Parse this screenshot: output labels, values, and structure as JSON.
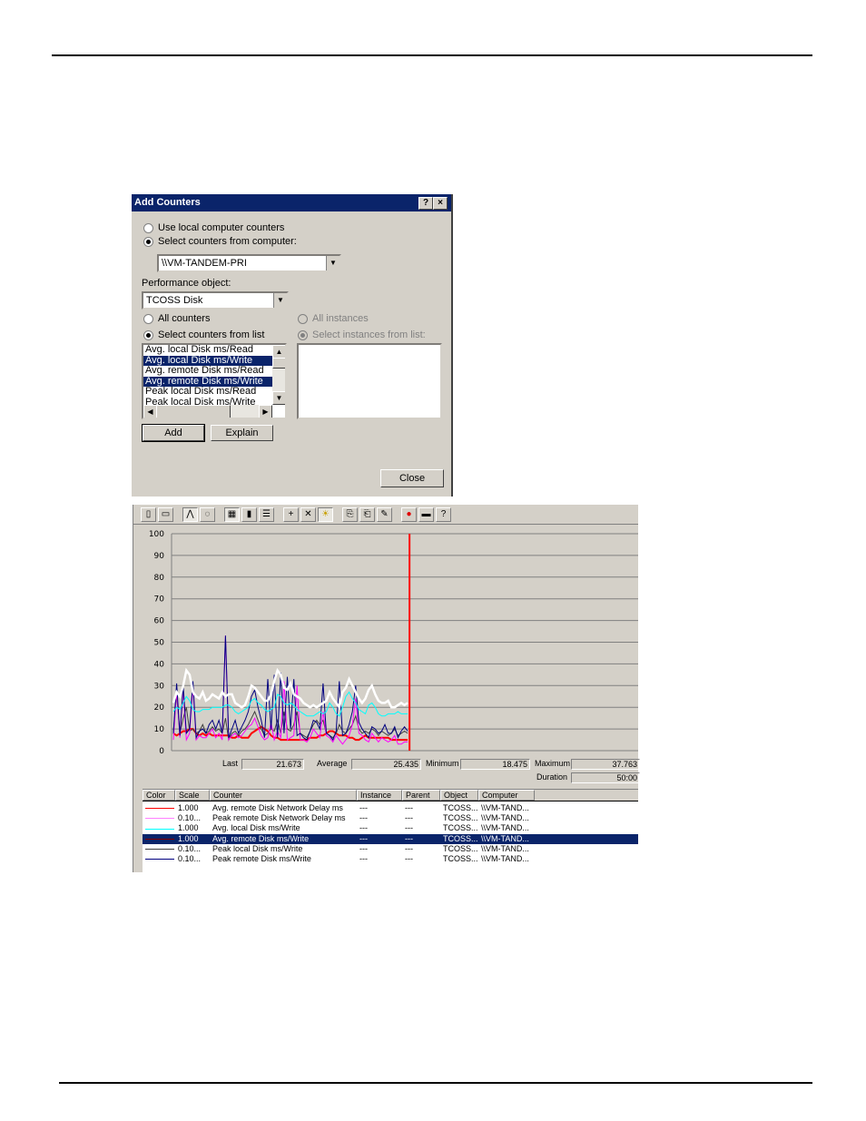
{
  "page": {
    "top_rule": true,
    "bottom_rule": true
  },
  "dialog": {
    "title": "Add Counters",
    "help_button": "?",
    "close_button": "×",
    "radio_local": "Use local computer counters",
    "radio_select": "Select counters from computer:",
    "computer_value": "\\\\VM-TANDEM-PRI",
    "performance_object_label": "Performance object:",
    "performance_object_value": "TCOSS Disk",
    "radio_all_counters": "All counters",
    "radio_select_counters": "Select counters from list",
    "radio_all_instances": "All instances",
    "radio_select_instances": "Select instances from list:",
    "counters": [
      {
        "label": "Avg. local Disk ms/Read",
        "selected": false
      },
      {
        "label": "Avg. local Disk ms/Write",
        "selected": true
      },
      {
        "label": "Avg. remote Disk ms/Read",
        "selected": false
      },
      {
        "label": "Avg. remote Disk ms/Write",
        "selected": true
      },
      {
        "label": "Peak local Disk ms/Read",
        "selected": false
      },
      {
        "label": "Peak local Disk ms/Write",
        "selected": false
      }
    ],
    "add_button": "Add",
    "explain_button": "Explain",
    "close_label": "Close"
  },
  "perfmon": {
    "toolbar_icons": [
      "new-counter-set-icon",
      "clear-display-icon",
      "view-current-activity-icon",
      "view-log-data-icon",
      "view-graph-icon",
      "view-histogram-icon",
      "view-report-icon",
      "add-icon",
      "delete-icon",
      "highlight-icon",
      "copy-properties-icon",
      "paste-counter-list-icon",
      "properties-icon",
      "freeze-display-icon",
      "update-data-icon",
      "help-icon"
    ],
    "stats": {
      "last_label": "Last",
      "last_value": "21.673",
      "average_label": "Average",
      "average_value": "25.435",
      "minimum_label": "Minimum",
      "minimum_value": "18.475",
      "maximum_label": "Maximum",
      "maximum_value": "37.763",
      "duration_label": "Duration",
      "duration_value": "50:00"
    },
    "legend_headers": [
      "Color",
      "Scale",
      "Counter",
      "Instance",
      "Parent",
      "Object",
      "Computer"
    ],
    "legend_rows": [
      {
        "color": "#ff0000",
        "scale": "1.000",
        "counter": "Avg. remote Disk Network Delay ms",
        "instance": "---",
        "parent": "---",
        "object": "TCOSS...",
        "computer": "\\\\VM-TAND...",
        "selected": false
      },
      {
        "color": "#ff80ff",
        "scale": "0.10...",
        "counter": "Peak remote Disk Network Delay ms",
        "instance": "---",
        "parent": "---",
        "object": "TCOSS...",
        "computer": "\\\\VM-TAND...",
        "selected": false
      },
      {
        "color": "#00ffff",
        "scale": "1.000",
        "counter": "Avg. local Disk ms/Write",
        "instance": "---",
        "parent": "---",
        "object": "TCOSS...",
        "computer": "\\\\VM-TAND...",
        "selected": false
      },
      {
        "color": "#800000",
        "scale": "1.000",
        "counter": "Avg. remote Disk ms/Write",
        "instance": "---",
        "parent": "---",
        "object": "TCOSS...",
        "computer": "\\\\VM-TAND...",
        "selected": true
      },
      {
        "color": "#404040",
        "scale": "0.10...",
        "counter": "Peak local Disk ms/Write",
        "instance": "---",
        "parent": "---",
        "object": "TCOSS...",
        "computer": "\\\\VM-TAND...",
        "selected": false
      },
      {
        "color": "#000080",
        "scale": "0.10...",
        "counter": "Peak remote Disk ms/Write",
        "instance": "---",
        "parent": "---",
        "object": "TCOSS...",
        "computer": "\\\\VM-TAND...",
        "selected": false
      }
    ]
  },
  "chart_data": {
    "type": "line",
    "title": "",
    "xlabel": "",
    "ylabel": "",
    "ylim": [
      0,
      100
    ],
    "yticks": [
      "100",
      "90",
      "80",
      "70",
      "60",
      "50",
      "40",
      "30",
      "20",
      "10",
      "0"
    ],
    "grid": true,
    "current_time_marker_fraction": 0.51,
    "series": [
      {
        "name": "Avg. remote Disk ms/Write (highlighted)",
        "color": "#ffffff",
        "values": [
          22,
          27,
          25,
          30,
          37,
          35,
          27,
          25,
          24,
          27,
          23,
          24,
          26,
          25,
          24,
          27,
          25,
          26,
          26,
          22,
          21,
          20,
          21,
          25,
          30,
          29,
          27,
          25,
          23,
          23,
          26,
          32,
          37,
          35,
          29,
          28,
          31,
          26,
          25,
          24,
          22,
          21,
          20,
          21,
          20,
          21,
          22,
          23,
          27,
          24,
          22,
          20,
          27,
          29,
          33,
          30,
          27,
          24,
          22,
          24,
          28,
          30,
          26,
          23,
          22,
          22,
          23,
          20,
          20,
          21,
          22,
          21,
          22
        ]
      },
      {
        "name": "Avg. local Disk ms/Write",
        "color": "#00ffff",
        "values": [
          18,
          20,
          19,
          22,
          25,
          23,
          19,
          18,
          18,
          19,
          19,
          19,
          20,
          20,
          20,
          20,
          21,
          21,
          20,
          18,
          17,
          18,
          19,
          20,
          23,
          24,
          22,
          21,
          19,
          18,
          19,
          20,
          26,
          25,
          22,
          21,
          22,
          21,
          19,
          18,
          17,
          16,
          16,
          16,
          17,
          18,
          17,
          18,
          22,
          20,
          17,
          16,
          20,
          25,
          27,
          24,
          22,
          19,
          18,
          17,
          21,
          22,
          20,
          17,
          16,
          16,
          17,
          17,
          17,
          18,
          17,
          17,
          17
        ]
      },
      {
        "name": "Avg. remote Disk Network Delay ms",
        "color": "#ff0000",
        "values": [
          8,
          7,
          8,
          9,
          9,
          10,
          10,
          8,
          7,
          8,
          7,
          8,
          7,
          7,
          7,
          7,
          7,
          7,
          6,
          6,
          7,
          6,
          6,
          6,
          8,
          9,
          10,
          11,
          10,
          9,
          7,
          6,
          6,
          5,
          5,
          5,
          5,
          5,
          5,
          5,
          5,
          5,
          6,
          6,
          6,
          7,
          7,
          8,
          9,
          9,
          8,
          7,
          7,
          7,
          6,
          6,
          5,
          5,
          6,
          7,
          6,
          6,
          6,
          6,
          6,
          6,
          6,
          5,
          5,
          5,
          5,
          5,
          5
        ]
      },
      {
        "name": "Peak remote Disk Network Delay ms",
        "color": "#ff00ff",
        "values": [
          5,
          28,
          6,
          28,
          5,
          8,
          30,
          5,
          7,
          6,
          6,
          8,
          10,
          6,
          8,
          5,
          53,
          5,
          7,
          8,
          6,
          7,
          9,
          11,
          12,
          15,
          11,
          7,
          5,
          6,
          13,
          5,
          9,
          6,
          32,
          5,
          6,
          7,
          30,
          5,
          5,
          4,
          6,
          10,
          8,
          6,
          18,
          7,
          6,
          4,
          7,
          5,
          3,
          5,
          7,
          12,
          24,
          8,
          7,
          5,
          4,
          8,
          6,
          4,
          6,
          5,
          4,
          5,
          7,
          3,
          3,
          4,
          4
        ]
      },
      {
        "name": "Peak local Disk ms/Write",
        "color": "#404040",
        "values": [
          9,
          26,
          8,
          15,
          20,
          9,
          10,
          8,
          9,
          12,
          8,
          9,
          11,
          9,
          10,
          8,
          15,
          5,
          8,
          9,
          7,
          9,
          10,
          12,
          15,
          18,
          14,
          10,
          7,
          8,
          10,
          9,
          14,
          8,
          18,
          10,
          9,
          12,
          18,
          8,
          7,
          6,
          9,
          12,
          14,
          12,
          14,
          8,
          7,
          6,
          8,
          12,
          9,
          8,
          10,
          12,
          16,
          10,
          8,
          9,
          8,
          10,
          9,
          7,
          9,
          8,
          7,
          8,
          10,
          7,
          8,
          9,
          8
        ]
      },
      {
        "name": "Peak remote Disk ms/Write",
        "color": "#000080",
        "values": [
          8,
          31,
          7,
          30,
          8,
          10,
          32,
          6,
          9,
          10,
          8,
          12,
          14,
          10,
          14,
          8,
          53,
          6,
          10,
          14,
          8,
          11,
          14,
          18,
          25,
          28,
          20,
          14,
          6,
          33,
          10,
          35,
          6,
          36,
          8,
          34,
          10,
          33,
          7,
          8,
          6,
          5,
          9,
          14,
          13,
          10,
          31,
          8,
          7,
          5,
          9,
          32,
          7,
          8,
          12,
          18,
          30,
          13,
          10,
          8,
          6,
          11,
          10,
          8,
          9,
          12,
          8,
          8,
          11,
          6,
          9,
          11,
          9
        ]
      }
    ]
  }
}
